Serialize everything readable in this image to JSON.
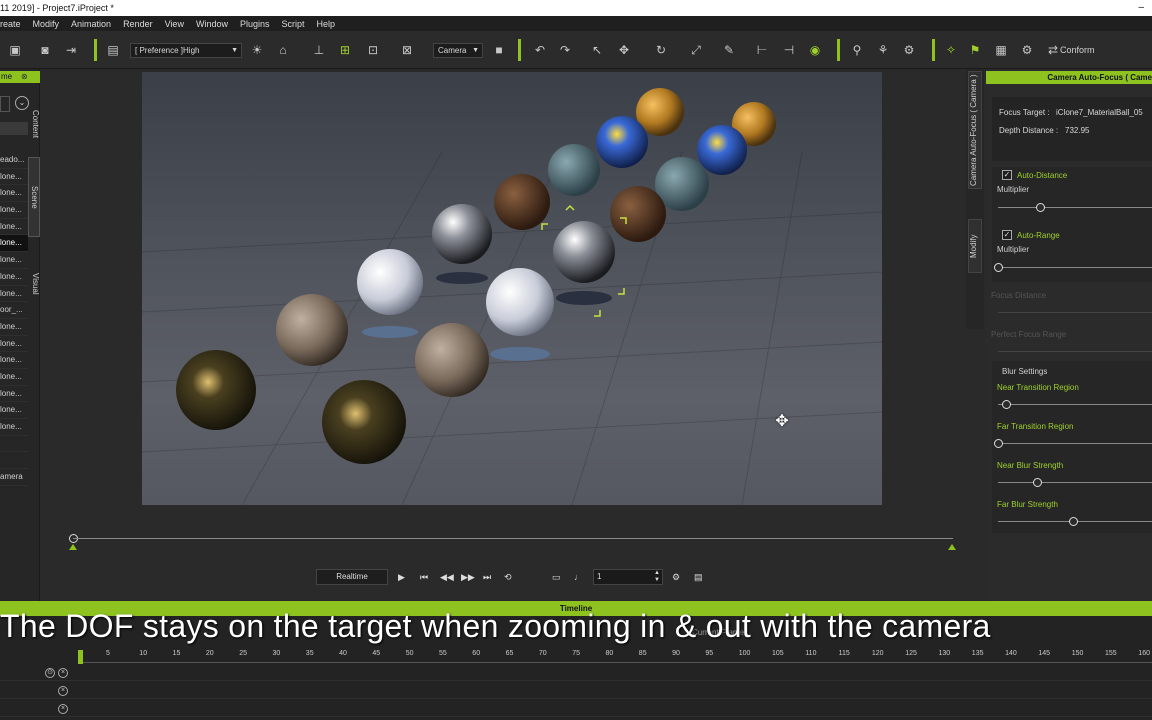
{
  "app": {
    "title": "11 2019] - Project7.iProject *",
    "minimize_glyph": "–"
  },
  "menu": [
    "reate",
    "Modify",
    "Animation",
    "Render",
    "View",
    "Window",
    "Plugins",
    "Script",
    "Help"
  ],
  "toolbar": {
    "preference_select": "[ Preference ]High",
    "camera_select": "Camera",
    "conform_label": "Conform",
    "accent_color": "#8dc21f"
  },
  "left_panel": {
    "header": "me",
    "tabs": [
      "Content",
      "Scene",
      "Visual"
    ],
    "items": [
      "eado...",
      "lone...",
      "lone...",
      "lone...",
      "lone...",
      "lone...",
      "lone...",
      "lone...",
      "lone...",
      "oor_...",
      "lone...",
      "lone...",
      "lone...",
      "lone...",
      "lone...",
      "lone...",
      "lone...",
      "",
      "",
      "amera"
    ],
    "selected_index": 5
  },
  "viewport": {
    "playback": {
      "realtime_label": "Realtime",
      "frame_value": "1"
    }
  },
  "right_tabs": [
    "Camera Auto-Focus ( Camera )",
    "Modify"
  ],
  "right_panel": {
    "header": "Camera Auto-Focus ( Came",
    "focus_target_label": "Focus Target :",
    "focus_target_value": "iClone7_MaterialBall_05",
    "depth_distance_label": "Depth Distance :",
    "depth_distance_value": "732.95",
    "auto_distance": {
      "label": "Auto-Distance",
      "checked": true,
      "multiplier_label": "Multiplier",
      "multiplier_level": 0.27
    },
    "auto_range": {
      "label": "Auto-Range",
      "checked": true,
      "multiplier_label": "Multiplier",
      "multiplier_level": 0.0
    },
    "disabled": [
      "Focus Distance",
      "Perfect Focus Range"
    ],
    "blur_settings": {
      "title": "Blur Settings",
      "sliders": [
        {
          "label": "Near Transition Region",
          "level": 0.05
        },
        {
          "label": "Far Transition Region",
          "level": 0.0
        },
        {
          "label": "Near Blur Strength",
          "level": 0.25
        },
        {
          "label": "Far Blur Strength",
          "level": 0.49
        }
      ]
    }
  },
  "timeline": {
    "header": "Timeline",
    "current_frame_label": "Current Frame",
    "ticks": [
      "5",
      "10",
      "15",
      "20",
      "25",
      "30",
      "35",
      "40",
      "45",
      "50",
      "55",
      "60",
      "65",
      "70",
      "75",
      "80",
      "85",
      "90",
      "95",
      "100",
      "105",
      "110",
      "115",
      "120",
      "125",
      "130",
      "135",
      "140",
      "145",
      "150",
      "155",
      "160"
    ]
  },
  "caption": "The DOF stays on the target when zooming in & out with the camera"
}
